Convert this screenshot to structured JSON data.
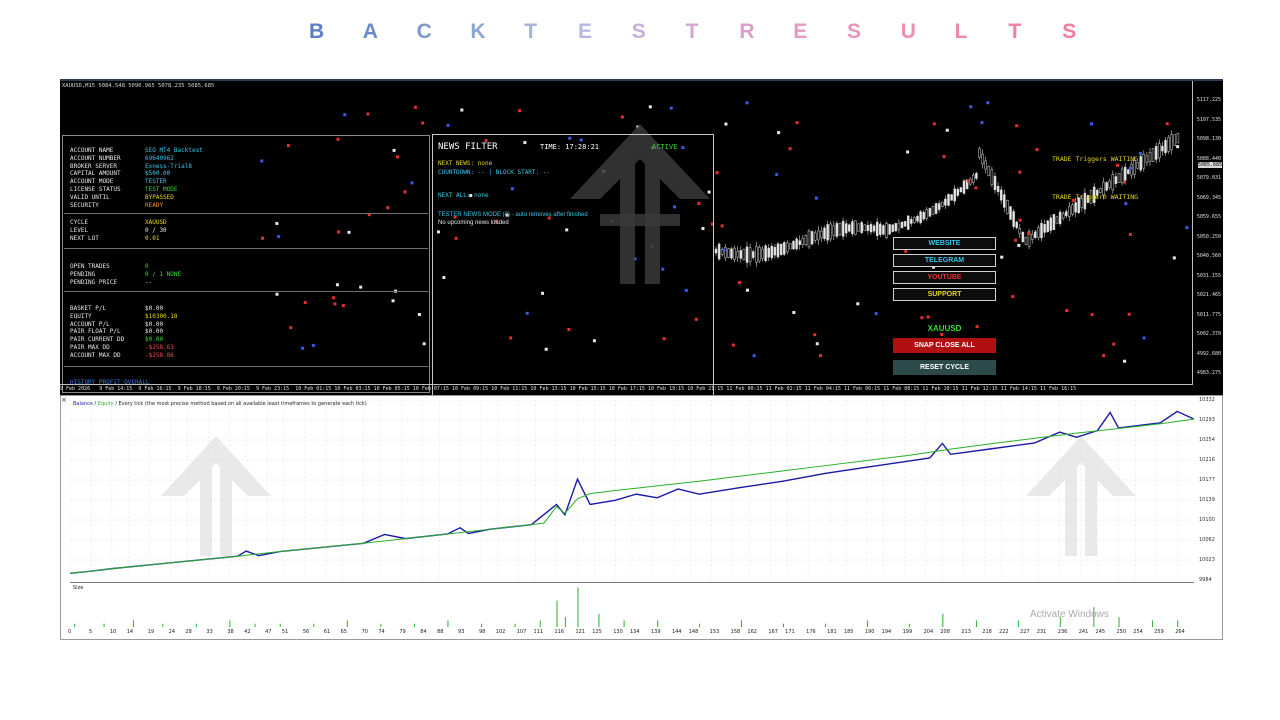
{
  "page_title": [
    "B",
    "A",
    "C",
    "K",
    "T",
    "E",
    "S",
    "T",
    "R",
    "E",
    "S",
    "U",
    "L",
    "T",
    "S"
  ],
  "title_colors": [
    "#5b7fc4",
    "#6a8bc9",
    "#7d99cf",
    "#8ba4d3",
    "#a2b1dc",
    "#b8b7e0",
    "#c6aedb",
    "#d2a6d4",
    "#dc9fcc",
    "#e39ac5",
    "#e894bd",
    "#ec8eb4",
    "#ee88ab",
    "#ef83a4",
    "#ef7c9b"
  ],
  "chart_header": "XAUUSD,M15  5084.548 5090.965 5078.235 5085.685",
  "account": {
    "rows": [
      {
        "label": "ACCOUNT NAME",
        "value": "SEO MT4 Backtest",
        "color": "#38c8e8"
      },
      {
        "label": "ACCOUNT NUMBER",
        "value": "69640962",
        "color": "#38c8e8"
      },
      {
        "label": "BROKER SERVER",
        "value": "Exness-Trial8",
        "color": "#38c8e8"
      },
      {
        "label": "CAPITAL AMOUNT",
        "value": "$500.00",
        "color": "#38c8e8"
      },
      {
        "label": "ACCOUNT MODE",
        "value": "TESTER",
        "color": "#38c8e8"
      },
      {
        "label": "LICENSE STATUS",
        "value": "TEST MODE",
        "color": "#38d838"
      },
      {
        "label": "VALID UNTIL",
        "value": "BYPASSED",
        "color": "#e8d820"
      },
      {
        "label": "SECURITY",
        "value": "READY",
        "color": "#e89020"
      }
    ],
    "cycle_rows": [
      {
        "label": "CYCLE",
        "value": "XAUUSD",
        "color": "#e8d820"
      },
      {
        "label": "LEVEL",
        "value": "0 / 30",
        "color": "#e8e8e8"
      },
      {
        "label": "NEXT LOT",
        "value": "0.01",
        "color": "#e8d820"
      }
    ],
    "trade_rows": [
      {
        "label": "OPEN TRADES",
        "value": "0",
        "color": "#38d838"
      },
      {
        "label": "PENDING",
        "value": "0 / 1   NONE",
        "color": "#38d838"
      },
      {
        "label": "PENDING PRICE",
        "value": "--",
        "color": "#e8e8e8"
      }
    ],
    "pl_rows": [
      {
        "label": "BASKET P/L",
        "value": "$0.00",
        "color": "#e8e8e8"
      },
      {
        "label": "EQUITY",
        "value": "$10300.18",
        "color": "#e8d820"
      },
      {
        "label": "ACCOUNT P/L",
        "value": "$0.00",
        "color": "#e8e8e8"
      },
      {
        "label": "PAIR FLOAT P/L",
        "value": "$0.00",
        "color": "#e8e8e8"
      },
      {
        "label": "PAIR CURRENT DD",
        "value": "$0.00",
        "color": "#38d838"
      },
      {
        "label": "PAIR MAX DD",
        "value": "-$258.63",
        "color": "#e85050"
      },
      {
        "label": "ACCOUNT MAX DD",
        "value": "-$258.86",
        "color": "#e85050"
      }
    ],
    "history_label": "HISTORY PROFIT OVERALL"
  },
  "news": {
    "title": "NEWS FILTER",
    "time": "TIME:  17:28:21",
    "status": "ACTIVE",
    "next_news": "NEXT NEWS: none",
    "countdown": "COUNTDOWN: -- | BLOCK START: --",
    "next_all": "NEXT ALL: none",
    "tester_mode": "TESTER NEWS MODE (0) - auto removes after finished",
    "no_upcoming": "No upcoming news loaded"
  },
  "trade_labels": {
    "t1": "TRADE Triggers WAITING",
    "t2": "TRADE Trigger0 WAITING"
  },
  "buttons": {
    "website": "WEBSITE",
    "telegram": "TELEGRAM",
    "youtube": "YOUTUBE",
    "support": "SUPPORT",
    "symbol": "XAUUSD",
    "snap_close": "SNAP CLOSE ALL",
    "reset_cycle": "RESET CYCLE"
  },
  "price_current": "5085.685",
  "price_axis": [
    "5117.225",
    "5107.535",
    "5098.130",
    "5088.440",
    "5079.031",
    "5069.345",
    "5059.655",
    "5050.250",
    "5040.560",
    "5031.155",
    "5021.465",
    "5011.775",
    "5002.370",
    "4992.680",
    "4983.275"
  ],
  "time_axis": [
    "9 Feb 2026",
    "9 Feb 14:15",
    "9 Feb 16:15",
    "9 Feb 18:15",
    "9 Feb 20:15",
    "9 Feb 23:15",
    "10 Feb 01:15",
    "10 Feb 03:15",
    "10 Feb 05:15",
    "10 Feb 07:15",
    "10 Feb 09:15",
    "10 Feb 11:15",
    "10 Feb 13:15",
    "10 Feb 15:15",
    "10 Feb 17:15",
    "10 Feb 19:15",
    "10 Feb 21:15",
    "11 Feb 00:15",
    "11 Feb 02:15",
    "11 Feb 04:15",
    "11 Feb 06:15",
    "11 Feb 08:15",
    "11 Feb 10:15",
    "11 Feb 12:15",
    "11 Feb 14:15",
    "11 Feb 16:15"
  ],
  "tester": {
    "legend_balance": "Balance",
    "legend_sep": "/",
    "legend_equity": "Equity",
    "legend_desc": "/ Every tick (the most precise method based on all available least timeframes to generate each tick)",
    "size_label": "Size",
    "activate": "Activate Windows"
  },
  "colors": {
    "balance": "#1a1aa8",
    "equity": "#28b028",
    "size": "#28b028"
  },
  "chart_data": {
    "type": "line",
    "title": "",
    "xlabel": "",
    "ylabel": "",
    "ylim": [
      9984,
      10332
    ],
    "y_ticks": [
      10332,
      10293,
      10254,
      10216,
      10177,
      10139,
      10100,
      10062,
      10023,
      9984
    ],
    "x_ticks": [
      0,
      5,
      10,
      14,
      19,
      24,
      28,
      33,
      38,
      42,
      47,
      51,
      56,
      61,
      65,
      70,
      74,
      79,
      84,
      88,
      93,
      98,
      102,
      107,
      111,
      116,
      121,
      125,
      130,
      134,
      139,
      144,
      148,
      153,
      158,
      162,
      167,
      171,
      176,
      181,
      185,
      190,
      194,
      199,
      204,
      208,
      213,
      218,
      222,
      227,
      231,
      236,
      241,
      245,
      250,
      254,
      259,
      264
    ],
    "xlim": [
      0,
      268
    ],
    "series": [
      {
        "name": "Balance",
        "x": [
          0,
          5,
          10,
          20,
          30,
          40,
          50,
          60,
          70,
          80,
          90,
          100,
          110,
          113,
          116,
          118,
          121,
          124,
          130,
          140,
          150,
          160,
          170,
          180,
          190,
          200,
          210,
          220,
          230,
          240,
          250,
          260,
          268
        ],
        "values": [
          9997,
          10001,
          10006,
          10014,
          10022,
          10030,
          10039,
          10047,
          10055,
          10064,
          10073,
          10082,
          10091,
          10094,
          10126,
          10113,
          10141,
          10151,
          10157,
          10166,
          10175,
          10185,
          10195,
          10205,
          10215,
          10225,
          10237,
          10248,
          10258,
          10268,
          10277,
          10286,
          10295
        ]
      },
      {
        "name": "Equity",
        "x": [
          0,
          5,
          10,
          20,
          30,
          40,
          42,
          45,
          50,
          60,
          70,
          75,
          80,
          90,
          93,
          95,
          100,
          110,
          116,
          118,
          121,
          124,
          130,
          135,
          140,
          145,
          150,
          160,
          170,
          180,
          190,
          200,
          205,
          208,
          210,
          220,
          230,
          236,
          240,
          245,
          248,
          250,
          260,
          264,
          268
        ],
        "values": [
          9997,
          10001,
          10006,
          10014,
          10022,
          10030,
          10040,
          10031,
          10039,
          10047,
          10055,
          10072,
          10064,
          10073,
          10085,
          10074,
          10082,
          10091,
          10130,
          10110,
          10179,
          10130,
          10138,
          10150,
          10143,
          10160,
          10150,
          10163,
          10175,
          10190,
          10202,
          10214,
          10220,
          10248,
          10227,
          10238,
          10249,
          10270,
          10260,
          10273,
          10308,
          10278,
          10288,
          10310,
          10295
        ]
      }
    ],
    "size": {
      "x": [
        1,
        8,
        15,
        22,
        30,
        38,
        44,
        50,
        58,
        66,
        74,
        82,
        90,
        98,
        106,
        112,
        116,
        118,
        121,
        126,
        132,
        140,
        150,
        160,
        170,
        180,
        190,
        200,
        208,
        216,
        226,
        236,
        244,
        250,
        258,
        264
      ],
      "values": [
        1,
        1,
        2,
        1,
        1,
        2,
        1,
        1,
        1,
        2,
        1,
        1,
        2,
        1,
        1,
        2,
        8,
        3,
        12,
        4,
        2,
        2,
        1,
        2,
        1,
        1,
        2,
        1,
        4,
        2,
        2,
        3,
        6,
        3,
        2,
        2
      ]
    }
  }
}
